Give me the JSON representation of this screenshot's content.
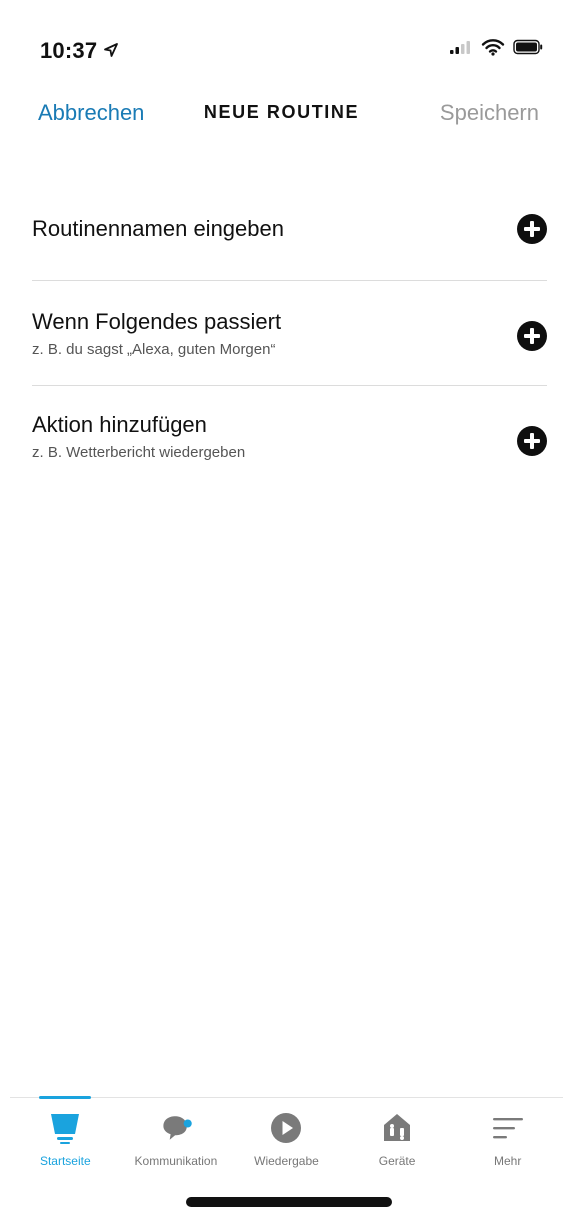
{
  "status_bar": {
    "time": "10:37"
  },
  "header": {
    "cancel_label": "Abbrechen",
    "title": "NEUE ROUTINE",
    "save_label": "Speichern"
  },
  "rows": [
    {
      "title": "Routinennamen eingeben",
      "subtitle": ""
    },
    {
      "title": "Wenn Folgendes passiert",
      "subtitle": "z. B. du sagst „Alexa, guten Morgen“"
    },
    {
      "title": "Aktion hinzufügen",
      "subtitle": "z. B. Wetterbericht wiedergeben"
    }
  ],
  "tabs": [
    {
      "label": "Startseite",
      "icon": "home-icon",
      "active": true
    },
    {
      "label": "Kommunikation",
      "icon": "chat-bubble-icon",
      "active": false
    },
    {
      "label": "Wiedergabe",
      "icon": "play-icon",
      "active": false
    },
    {
      "label": "Geräte",
      "icon": "devices-house-icon",
      "active": false
    },
    {
      "label": "Mehr",
      "icon": "menu-lines-icon",
      "active": false
    }
  ],
  "colors": {
    "accent": "#1aa3de",
    "link": "#1a7bb5",
    "disabled": "#9a9a9a"
  }
}
